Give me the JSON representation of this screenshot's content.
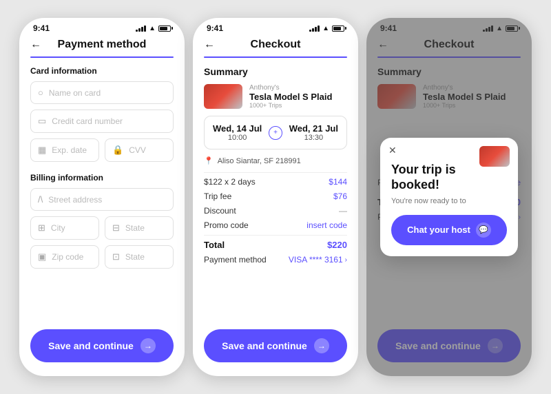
{
  "phones": [
    {
      "id": "payment",
      "status": {
        "time": "9:41"
      },
      "header": {
        "title": "Payment method",
        "back": "←"
      },
      "card_section": {
        "label": "Card information",
        "name_placeholder": "Name on card",
        "number_placeholder": "Credit card number",
        "exp_placeholder": "Exp. date",
        "cvv_placeholder": "CVV"
      },
      "billing_section": {
        "label": "Billing information",
        "street_placeholder": "Street address",
        "city_placeholder": "City",
        "state_placeholder": "State",
        "zip_placeholder": "Zip code",
        "state2_placeholder": "State"
      },
      "button": {
        "label": "Save and continue"
      }
    },
    {
      "id": "checkout",
      "status": {
        "time": "9:41"
      },
      "header": {
        "title": "Checkout",
        "back": "←"
      },
      "summary": {
        "title": "Summary",
        "car_owner": "Anthony's",
        "car_name": "Tesla Model S Plaid",
        "car_trips": "1000+ Trips"
      },
      "dates": {
        "start_date": "Wed, 14 Jul",
        "start_time": "10:00",
        "end_date": "Wed, 21 Jul",
        "end_time": "13:30"
      },
      "location": "Aliso Siantar, SF 218991",
      "pricing": {
        "base": "$122 x 2 days",
        "base_val": "$144",
        "fee_label": "Trip fee",
        "fee_val": "$76",
        "discount_label": "Discount",
        "discount_val": "—",
        "promo_label": "Promo code",
        "promo_val": "insert code",
        "total_label": "Total",
        "total_val": "$220",
        "payment_label": "Payment method",
        "payment_val": "VISA **** 3161"
      },
      "button": {
        "label": "Save and continue"
      }
    },
    {
      "id": "checkout-booked",
      "status": {
        "time": "9:41"
      },
      "header": {
        "title": "Checkout",
        "back": "←"
      },
      "summary": {
        "title": "Summary",
        "car_owner": "Anthony's",
        "car_name": "Tesla Model S Plaid",
        "car_trips": "1000+ Trips"
      },
      "modal": {
        "title": "Your trip is booked!",
        "subtitle": "You're now ready to to",
        "chat_btn": "Chat your host"
      },
      "pricing": {
        "promo_label": "Promo code",
        "promo_val": "insert code",
        "total_label": "Total",
        "total_val": "$220",
        "payment_label": "Payment method",
        "payment_val": "VISA **** 3161"
      },
      "button": {
        "label": "Save and continue"
      }
    }
  ]
}
